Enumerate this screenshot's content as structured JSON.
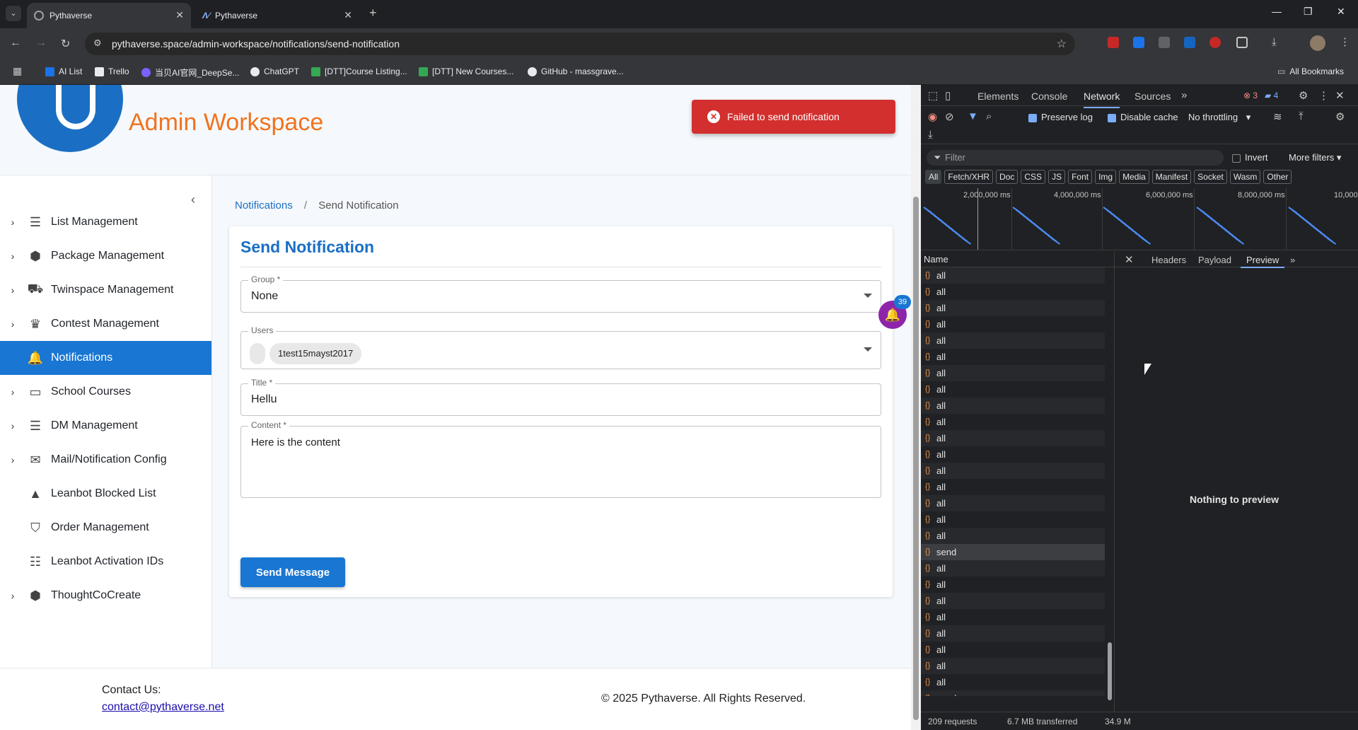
{
  "browser": {
    "tabs": [
      {
        "label": "Pythaverse",
        "active": true
      },
      {
        "label": "Pythaverse",
        "active": false
      }
    ],
    "url": "pythaverse.space/admin-workspace/notifications/send-notification",
    "bookmarks": [
      "AI List",
      "Trello",
      "当贝AI官网_DeepSe...",
      "ChatGPT",
      "[DTT]Course Listing...",
      "[DTT] New Courses...",
      "GitHub - massgrave..."
    ],
    "all_bookmarks": "All Bookmarks"
  },
  "header": {
    "brand": "Admin Workspace"
  },
  "toast": {
    "message": "Failed to send notification",
    "color": "#d32f2f"
  },
  "sidebar": {
    "items": [
      {
        "label": "List Management",
        "icon": "list-icon",
        "expandable": true
      },
      {
        "label": "Package Management",
        "icon": "package-icon",
        "expandable": true
      },
      {
        "label": "Twinspace Management",
        "icon": "car-icon",
        "expandable": true
      },
      {
        "label": "Contest Management",
        "icon": "trophy-icon",
        "expandable": true
      },
      {
        "label": "Notifications",
        "icon": "bell-icon",
        "expandable": false,
        "active": true
      },
      {
        "label": "School Courses",
        "icon": "book-icon",
        "expandable": true
      },
      {
        "label": "DM Management",
        "icon": "list-icon",
        "expandable": true
      },
      {
        "label": "Mail/Notification Config",
        "icon": "mail-icon",
        "expandable": true
      },
      {
        "label": "Leanbot Blocked List",
        "icon": "cone-icon",
        "expandable": false
      },
      {
        "label": "Order Management",
        "icon": "basket-icon",
        "expandable": false
      },
      {
        "label": "Leanbot Activation IDs",
        "icon": "checklist-icon",
        "expandable": false
      },
      {
        "label": "ThoughtCoCreate",
        "icon": "package-icon",
        "expandable": true
      }
    ]
  },
  "breadcrumb": {
    "parent": "Notifications",
    "separator": "/",
    "current": "Send Notification"
  },
  "form": {
    "title": "Send Notification",
    "group_label": "Group *",
    "group_value": "None",
    "users_label": "Users",
    "users_chip": "1test15mayst2017",
    "title_label": "Title *",
    "title_value": "Hellu",
    "content_label": "Content *",
    "content_value": "Here is the content",
    "submit": "Send Message"
  },
  "notification_bell": {
    "count": "39"
  },
  "footer": {
    "contact_label": "Contact Us:",
    "email": "contact@pythaverse.net",
    "copyright": "© 2025 Pythaverse. All Rights Reserved."
  },
  "devtools": {
    "tabs": [
      "Elements",
      "Console",
      "Network",
      "Sources"
    ],
    "active_tab": "Network",
    "errors": "3",
    "messages": "4",
    "preserve_log": "Preserve log",
    "disable_cache": "Disable cache",
    "throttling": "No throttling",
    "filter_placeholder": "Filter",
    "invert": "Invert",
    "more_filters": "More filters",
    "types": [
      "All",
      "Fetch/XHR",
      "Doc",
      "CSS",
      "JS",
      "Font",
      "Img",
      "Media",
      "Manifest",
      "Socket",
      "Wasm",
      "Other"
    ],
    "timeline_ticks": [
      "2,000,000 ms",
      "4,000,000 ms",
      "6,000,000 ms",
      "8,000,000 ms",
      "10,000"
    ],
    "name_header": "Name",
    "requests": [
      "all",
      "all",
      "all",
      "all",
      "all",
      "all",
      "all",
      "all",
      "all",
      "all",
      "all",
      "all",
      "all",
      "all",
      "all",
      "all",
      "all",
      "send",
      "all",
      "all",
      "all",
      "all",
      "all",
      "all",
      "all",
      "all",
      "send"
    ],
    "selected_request": 17,
    "detail_tabs": [
      "Headers",
      "Payload",
      "Preview"
    ],
    "active_detail": "Preview",
    "preview_empty": "Nothing to preview",
    "status_requests": "209 requests",
    "status_transferred": "6.7 MB transferred",
    "status_resources": "34.9 M"
  }
}
